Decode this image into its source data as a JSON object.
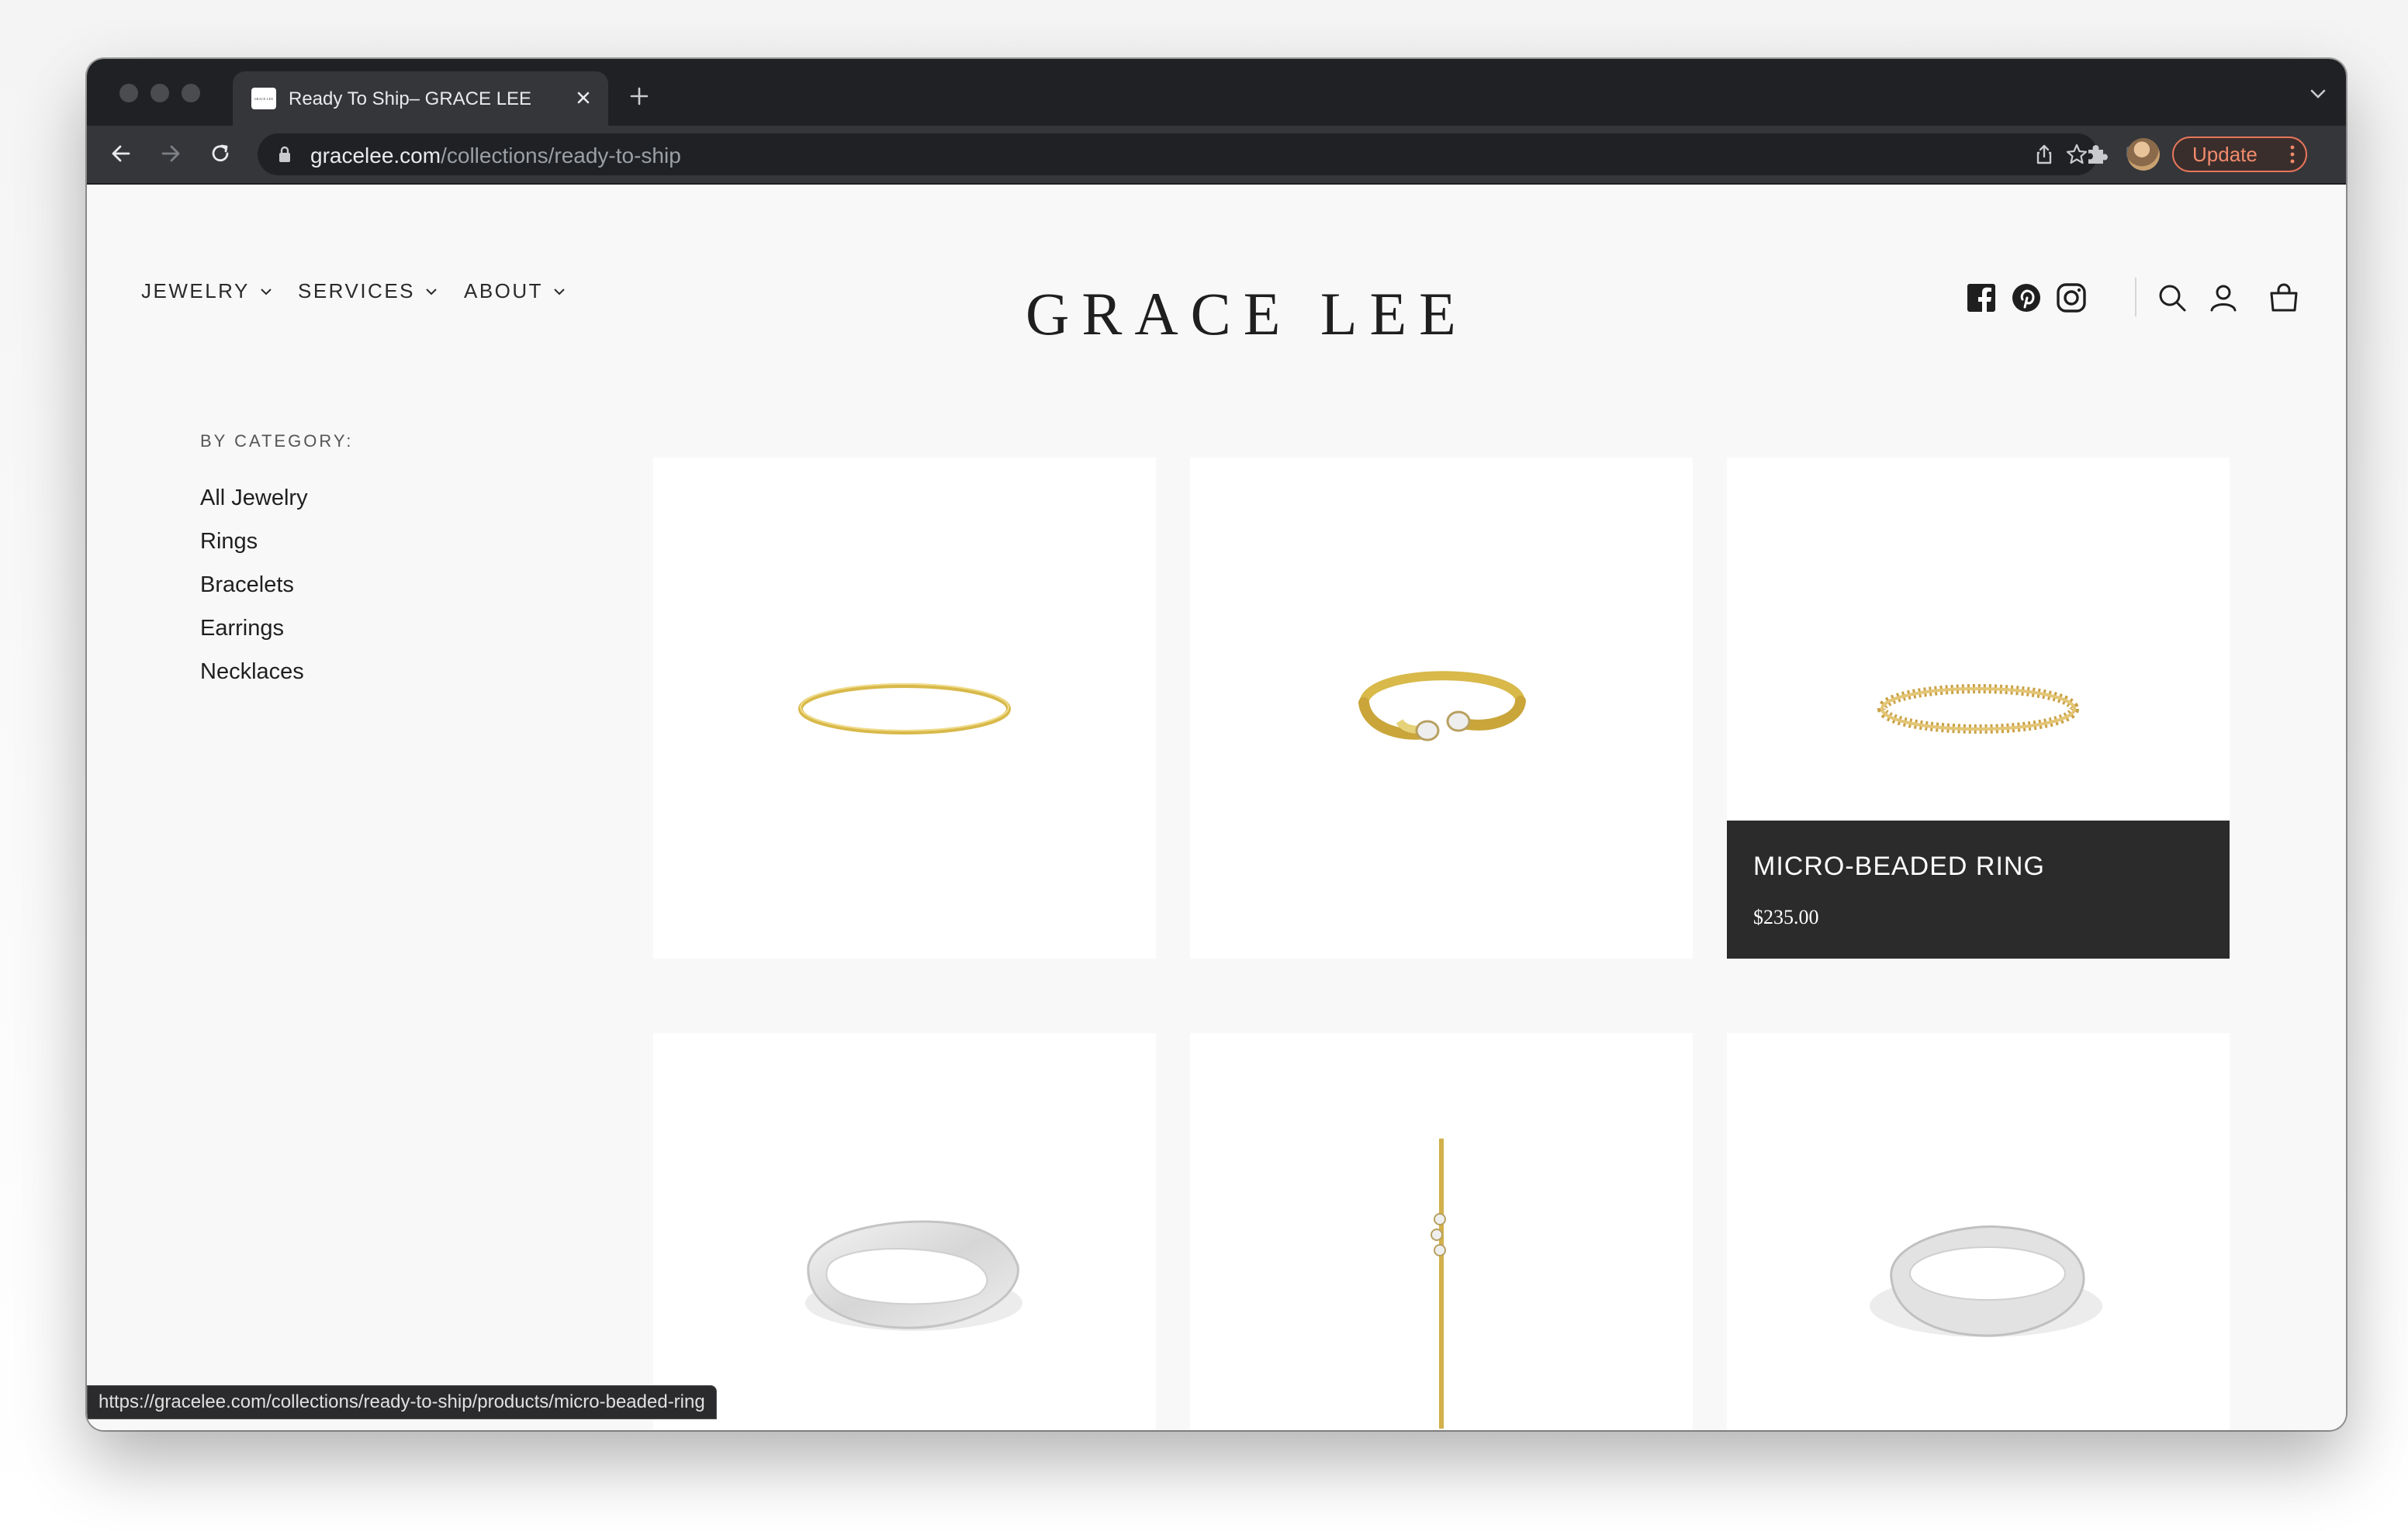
{
  "browser": {
    "tab_title": "Ready To Ship– GRACE LEE",
    "favicon_text": "GRACE LEE",
    "url_domain": "gracelee.com",
    "url_path": "/collections/ready-to-ship",
    "update_label": "Update",
    "status_url": "https://gracelee.com/collections/ready-to-ship/products/micro-beaded-ring"
  },
  "header": {
    "logo": "GRACE LEE",
    "nav": [
      {
        "label": "JEWELRY"
      },
      {
        "label": "SERVICES"
      },
      {
        "label": "ABOUT"
      }
    ]
  },
  "sidebar": {
    "heading": "BY CATEGORY:",
    "items": [
      {
        "label": "All Jewelry"
      },
      {
        "label": "Rings"
      },
      {
        "label": "Bracelets"
      },
      {
        "label": "Earrings"
      },
      {
        "label": "Necklaces"
      }
    ]
  },
  "products": {
    "hovered": {
      "name": "MICRO-BEADED RING",
      "price": "$235.00"
    }
  },
  "colors": {
    "chrome_dark": "#202124",
    "toolbar": "#35363a",
    "update_accent": "#e8765a",
    "overlay": "#2b2b2b",
    "gold": "#d8b94a"
  }
}
